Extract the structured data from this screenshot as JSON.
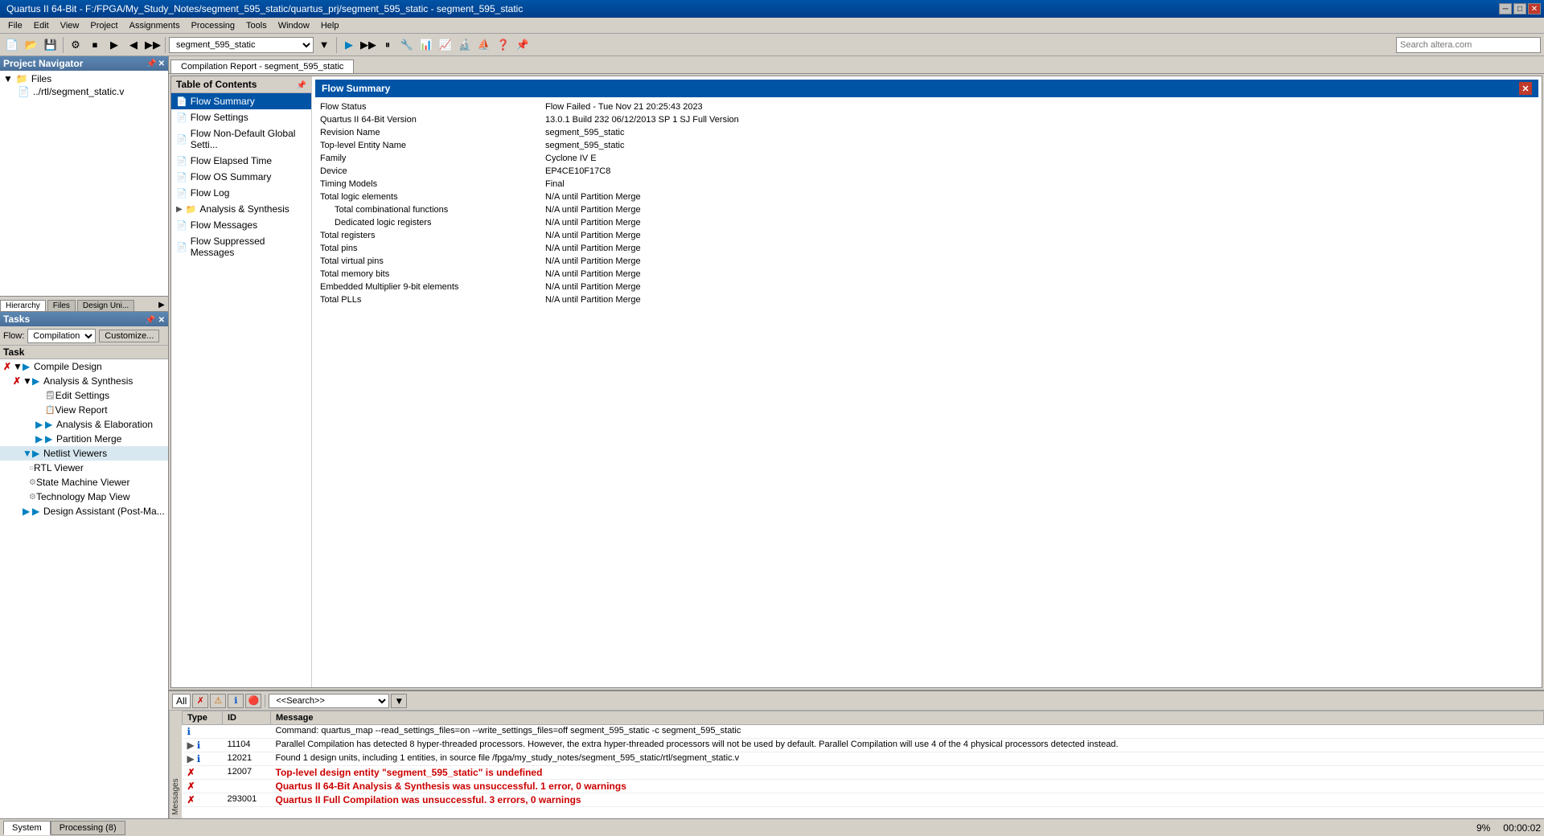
{
  "window": {
    "title": "Quartus II 64-Bit - F:/FPGA/My_Study_Notes/segment_595_static/quartus_prj/segment_595_static - segment_595_static"
  },
  "titlebar": {
    "minimize": "─",
    "maximize": "□",
    "close": "✕"
  },
  "menu": {
    "items": [
      "File",
      "Edit",
      "View",
      "Project",
      "Assignments",
      "Processing",
      "Tools",
      "Window",
      "Help"
    ]
  },
  "toolbar": {
    "project_select": "segment_595_static",
    "search_placeholder": "Search altera.com"
  },
  "project_navigator": {
    "title": "Project Navigator",
    "tabs": [
      "Hierarchy",
      "Files",
      "Design Uni..."
    ],
    "files": [
      {
        "name": "Files",
        "type": "folder"
      },
      {
        "name": "../rtl/segment_static.v",
        "type": "file"
      }
    ]
  },
  "tasks": {
    "title": "Tasks",
    "flow_label": "Flow:",
    "flow_value": "Compilation",
    "customize_label": "Customize...",
    "column_header": "Task",
    "items": [
      {
        "indent": 1,
        "status": "x",
        "expand": "▶",
        "label": "Compile Design",
        "icon": "folder"
      },
      {
        "indent": 2,
        "status": "x",
        "expand": "▶",
        "label": "Analysis & Synthesis",
        "icon": "folder"
      },
      {
        "indent": 3,
        "status": "",
        "expand": "",
        "label": "Edit Settings",
        "icon": "page"
      },
      {
        "indent": 3,
        "status": "",
        "expand": "",
        "label": "View Report",
        "icon": "page"
      },
      {
        "indent": 3,
        "status": "",
        "expand": "▶",
        "label": "Analysis & Elaboration",
        "icon": "folder"
      },
      {
        "indent": 3,
        "status": "",
        "expand": "▶",
        "label": "Partition Merge",
        "icon": "folder"
      },
      {
        "indent": 2,
        "status": "",
        "expand": "▼",
        "label": "Netlist Viewers",
        "icon": "folder"
      },
      {
        "indent": 3,
        "status": "",
        "expand": "",
        "label": "RTL Viewer",
        "icon": "circle"
      },
      {
        "indent": 3,
        "status": "",
        "expand": "",
        "label": "State Machine Viewer",
        "icon": "circle"
      },
      {
        "indent": 3,
        "status": "",
        "expand": "",
        "label": "Technology Map View",
        "icon": "circle"
      },
      {
        "indent": 2,
        "status": "",
        "expand": "▶",
        "label": "Design Assistant (Post-Ma...",
        "icon": "folder"
      }
    ]
  },
  "compilation_report": {
    "tab_label": "Compilation Report - segment_595_static",
    "close_label": "✕",
    "toc_header": "Table of Contents",
    "title": "Flow Summary",
    "toc_items": [
      {
        "label": "Flow Summary",
        "selected": true,
        "icon": "📄",
        "indent": 0
      },
      {
        "label": "Flow Settings",
        "selected": false,
        "icon": "📄",
        "indent": 0
      },
      {
        "label": "Flow Non-Default Global Settings",
        "selected": false,
        "icon": "📄",
        "indent": 0
      },
      {
        "label": "Flow Elapsed Time",
        "selected": false,
        "icon": "📄",
        "indent": 0
      },
      {
        "label": "Flow OS Summary",
        "selected": false,
        "icon": "📄",
        "indent": 0
      },
      {
        "label": "Flow Log",
        "selected": false,
        "icon": "📄",
        "indent": 0
      },
      {
        "label": "Analysis & Synthesis",
        "selected": false,
        "icon": "📁",
        "indent": 0,
        "expand": "▶"
      },
      {
        "label": "Flow Messages",
        "selected": false,
        "icon": "📄",
        "indent": 0
      },
      {
        "label": "Flow Suppressed Messages",
        "selected": false,
        "icon": "📄",
        "indent": 0
      }
    ],
    "rows": [
      {
        "label": "Flow Status",
        "value": "Flow Failed - Tue Nov 21 20:25:43 2023",
        "indent": false
      },
      {
        "label": "Quartus II 64-Bit Version",
        "value": "13.0.1 Build 232 06/12/2013 SP 1 SJ Full Version",
        "indent": false
      },
      {
        "label": "Revision Name",
        "value": "segment_595_static",
        "indent": false
      },
      {
        "label": "Top-level Entity Name",
        "value": "segment_595_static",
        "indent": false
      },
      {
        "label": "Family",
        "value": "Cyclone IV E",
        "indent": false
      },
      {
        "label": "Device",
        "value": "EP4CE10F17C8",
        "indent": false
      },
      {
        "label": "Timing Models",
        "value": "Final",
        "indent": false
      },
      {
        "label": "Total logic elements",
        "value": "N/A until Partition Merge",
        "indent": false
      },
      {
        "label": "Total combinational functions",
        "value": "N/A until Partition Merge",
        "indent": true
      },
      {
        "label": "Dedicated logic registers",
        "value": "N/A until Partition Merge",
        "indent": true
      },
      {
        "label": "Total registers",
        "value": "N/A until Partition Merge",
        "indent": false
      },
      {
        "label": "Total pins",
        "value": "N/A until Partition Merge",
        "indent": false
      },
      {
        "label": "Total virtual pins",
        "value": "N/A until Partition Merge",
        "indent": false
      },
      {
        "label": "Total memory bits",
        "value": "N/A until Partition Merge",
        "indent": false
      },
      {
        "label": "Embedded Multiplier 9-bit elements",
        "value": "N/A until Partition Merge",
        "indent": false
      },
      {
        "label": "Total PLLs",
        "value": "N/A until Partition Merge",
        "indent": false
      }
    ]
  },
  "messages": {
    "toolbar": {
      "all_label": "All",
      "search_placeholder": "<<Search>>"
    },
    "columns": [
      "Type",
      "ID",
      "Message"
    ],
    "rows": [
      {
        "type": "info",
        "id": "",
        "message": "Command: quartus_map --read_settings_files=on --write_settings_files=off segment_595_static -c segment_595_static",
        "expand": false
      },
      {
        "type": "info",
        "id": "11104",
        "message": "Parallel Compilation has detected 8 hyper-threaded processors. However, the extra hyper-threaded processors will not be used by default. Parallel Compilation will use 4 of the 4 physical processors detected instead.",
        "expand": true
      },
      {
        "type": "info",
        "id": "12021",
        "message": "Found 1 design units, including 1 entities, in source file /fpga/my_study_notes/segment_595_static/rtl/segment_static.v",
        "expand": true
      },
      {
        "type": "error",
        "id": "12007",
        "message": "Top-level design entity \"segment_595_static\" is undefined",
        "expand": false
      },
      {
        "type": "error",
        "id": "",
        "message": "Quartus II 64-Bit Analysis & Synthesis was unsuccessful. 1 error, 0 warnings",
        "expand": false
      },
      {
        "type": "error",
        "id": "293001",
        "message": "Quartus II Full Compilation was unsuccessful. 3 errors, 0 warnings",
        "expand": false
      }
    ]
  },
  "status_bar": {
    "tabs": [
      "System",
      "Processing (8)"
    ],
    "zoom": "9%",
    "time": "00:00:02"
  }
}
